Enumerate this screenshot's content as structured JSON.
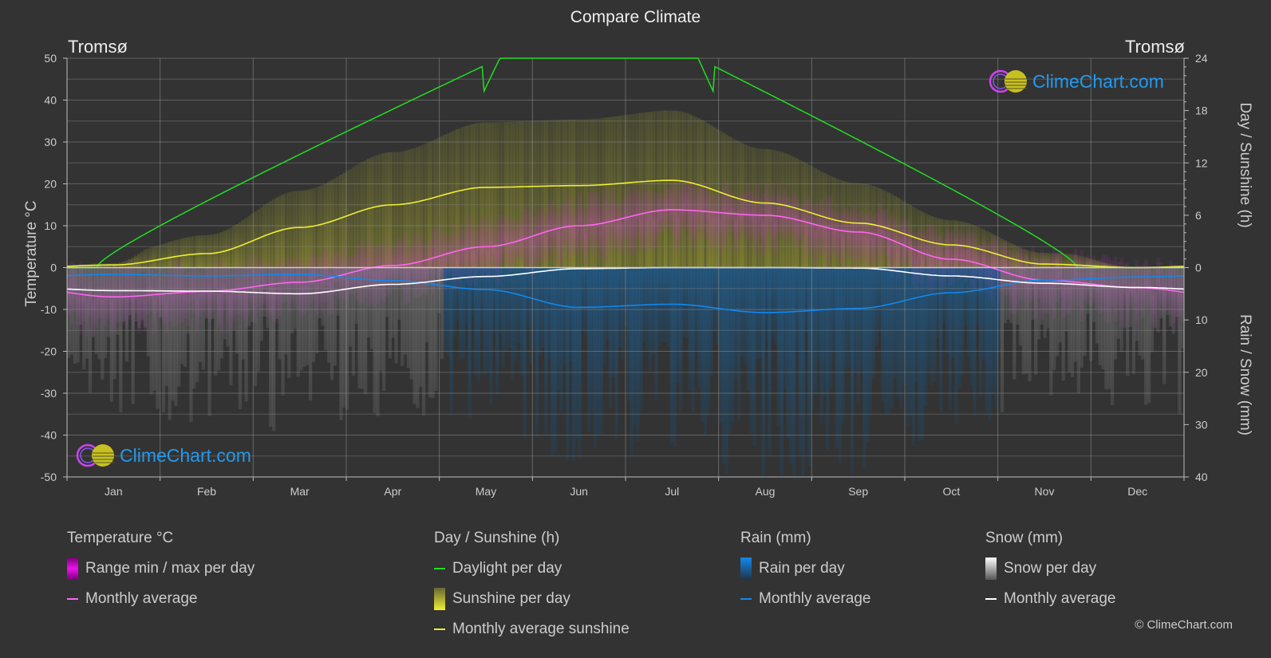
{
  "page": {
    "title": "Compare Climate",
    "city_left": "Tromsø",
    "city_right": "Tromsø",
    "logo_text": "ClimeChart.com",
    "copyright": "© ClimeChart.com"
  },
  "axes": {
    "left_title": "Temperature °C",
    "right_top_title": "Day / Sunshine (h)",
    "right_bottom_title": "Rain / Snow (mm)"
  },
  "legend": {
    "temperature": {
      "title": "Temperature °C",
      "items": [
        {
          "label": "Range min / max per day",
          "color": "#ee22ee",
          "kind": "box"
        },
        {
          "label": "Monthly average",
          "color": "#ff66ee",
          "kind": "line"
        }
      ]
    },
    "sunshine": {
      "title": "Day / Sunshine (h)",
      "items": [
        {
          "label": "Daylight per day",
          "color": "#22dd22",
          "kind": "line"
        },
        {
          "label": "Sunshine per day",
          "color": "#eeee33",
          "kind": "box"
        },
        {
          "label": "Monthly average sunshine",
          "color": "#eeee33",
          "kind": "line"
        }
      ]
    },
    "rain": {
      "title": "Rain (mm)",
      "items": [
        {
          "label": "Rain per day",
          "color": "#1188ee",
          "kind": "box"
        },
        {
          "label": "Monthly average",
          "color": "#1188ee",
          "kind": "line"
        }
      ]
    },
    "snow": {
      "title": "Snow (mm)",
      "items": [
        {
          "label": "Snow per day",
          "color": "#dddddd",
          "kind": "box"
        },
        {
          "label": "Monthly average",
          "color": "#ffffff",
          "kind": "line"
        }
      ]
    }
  },
  "chart_data": {
    "type": "line",
    "title": "Compare Climate",
    "location": "Tromsø",
    "categories": [
      "Jan",
      "Feb",
      "Mar",
      "Apr",
      "May",
      "Jun",
      "Jul",
      "Aug",
      "Sep",
      "Oct",
      "Nov",
      "Dec"
    ],
    "left_axis": {
      "label": "Temperature °C",
      "range": [
        -50,
        50
      ],
      "ticks": [
        50,
        40,
        30,
        20,
        10,
        0,
        -10,
        -20,
        -30,
        -40,
        -50
      ]
    },
    "right_axis_top": {
      "label": "Day / Sunshine (h)",
      "range": [
        0,
        24
      ],
      "ticks": [
        24,
        18,
        12,
        6,
        0
      ]
    },
    "right_axis_bottom": {
      "label": "Rain / Snow (mm)",
      "range": [
        0,
        40
      ],
      "ticks": [
        0,
        10,
        20,
        30,
        40
      ]
    },
    "grid": true,
    "series": [
      {
        "name": "Temperature monthly average",
        "unit": "°C",
        "color": "#ff66ee",
        "values": [
          -7.0,
          -5.7,
          -3.5,
          0.5,
          5.0,
          10.0,
          13.8,
          12.5,
          8.5,
          2.0,
          -3.0,
          -4.8
        ]
      },
      {
        "name": "Monthly average sunshine",
        "unit": "h",
        "color": "#eeee33",
        "values": [
          0.3,
          1.6,
          4.6,
          7.2,
          9.2,
          9.4,
          10.0,
          7.4,
          5.1,
          2.6,
          0.4,
          0.0
        ]
      },
      {
        "name": "Daylight per day",
        "unit": "h",
        "color": "#22dd22",
        "values": [
          0.5,
          6.5,
          11.5,
          16.5,
          22.5,
          24.0,
          24.0,
          20.5,
          14.5,
          9.0,
          2.0,
          0.0
        ]
      },
      {
        "name": "Rain monthly average",
        "unit": "mm",
        "color": "#1188ee",
        "values": [
          1.3,
          1.6,
          1.3,
          2.5,
          4.2,
          7.6,
          7.0,
          8.6,
          7.8,
          4.8,
          2.4,
          1.8
        ]
      },
      {
        "name": "Snow monthly average",
        "unit": "mm",
        "color": "#ffffff",
        "values": [
          4.4,
          4.5,
          5.0,
          3.2,
          1.7,
          0.2,
          0.0,
          0.0,
          0.1,
          1.6,
          3.0,
          3.8
        ]
      }
    ],
    "legend_position": "bottom"
  }
}
